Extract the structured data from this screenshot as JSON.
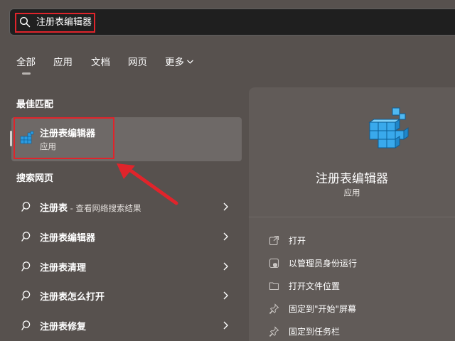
{
  "search": {
    "query": "注册表编辑器",
    "icon": "search-icon"
  },
  "tabs": [
    {
      "label": "全部"
    },
    {
      "label": "应用"
    },
    {
      "label": "文档"
    },
    {
      "label": "网页"
    },
    {
      "label": "更多"
    }
  ],
  "best_match": {
    "section_label": "最佳匹配",
    "title": "注册表编辑器",
    "subtitle": "应用"
  },
  "web_search": {
    "section_label": "搜索网页",
    "items": [
      {
        "label": "注册表",
        "suffix": " - 查看网络搜索结果"
      },
      {
        "label": "注册表编辑器",
        "suffix": ""
      },
      {
        "label": "注册表清理",
        "suffix": ""
      },
      {
        "label": "注册表怎么打开",
        "suffix": ""
      },
      {
        "label": "注册表修复",
        "suffix": ""
      }
    ]
  },
  "detail": {
    "title": "注册表编辑器",
    "subtitle": "应用",
    "actions": [
      {
        "label": "打开",
        "icon": "open-icon"
      },
      {
        "label": "以管理员身份运行",
        "icon": "run-as-admin-icon"
      },
      {
        "label": "打开文件位置",
        "icon": "folder-icon"
      },
      {
        "label": "固定到\"开始\"屏幕",
        "icon": "pin-icon"
      },
      {
        "label": "固定到任务栏",
        "icon": "pin-icon"
      }
    ]
  },
  "colors": {
    "background": "#57514e",
    "search_bar": "#1f1f1f",
    "highlight_red": "#e0242b",
    "registry_blue": "#2b9be0"
  }
}
